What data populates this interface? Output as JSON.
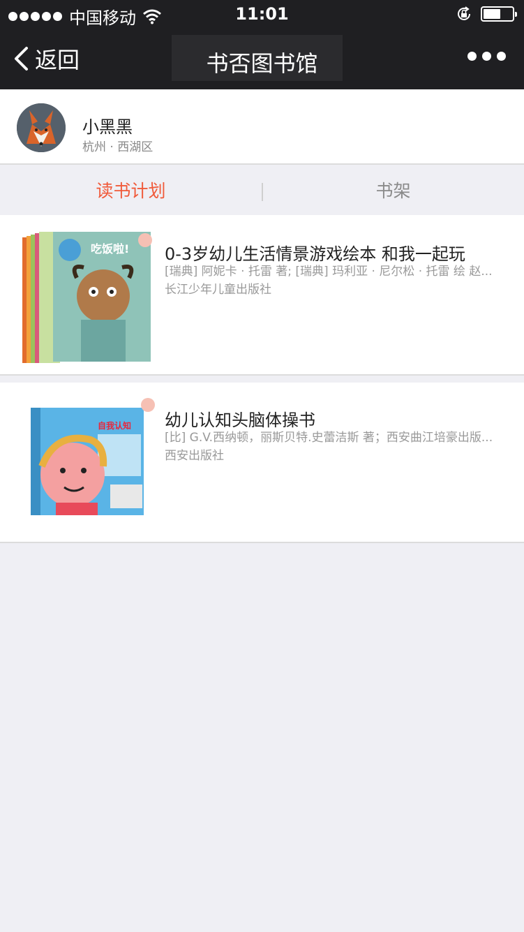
{
  "status_bar": {
    "carrier": "中国移动",
    "time": "11:01",
    "battery_level": 0.6
  },
  "nav": {
    "back_label": "返回",
    "title": "书否图书馆"
  },
  "profile": {
    "name": "小黑黑",
    "location": "杭州 · 西湖区"
  },
  "tabs": {
    "plan": "读书计划",
    "shelf": "书架"
  },
  "books": [
    {
      "title": "0-3岁幼儿生活情景游戏绘本 和我一起玩",
      "author": "[瑞典] 阿妮卡 · 托雷 著; [瑞典] 玛利亚 · 尼尔松 · 托雷 绘 赵...",
      "publisher": "长江少年儿童出版社",
      "cover_text": "吃饭啦!"
    },
    {
      "title": "幼儿认知头脑体操书",
      "author": "[比] G.V.西纳顿，丽斯贝特.史蕾洁斯 著；西安曲江培豪出版...",
      "publisher": "西安出版社",
      "cover_text": "自我认知"
    }
  ],
  "colors": {
    "accent": "#f05a3a",
    "nav_bg": "#1f1f22",
    "page_bg": "#efeff4"
  }
}
